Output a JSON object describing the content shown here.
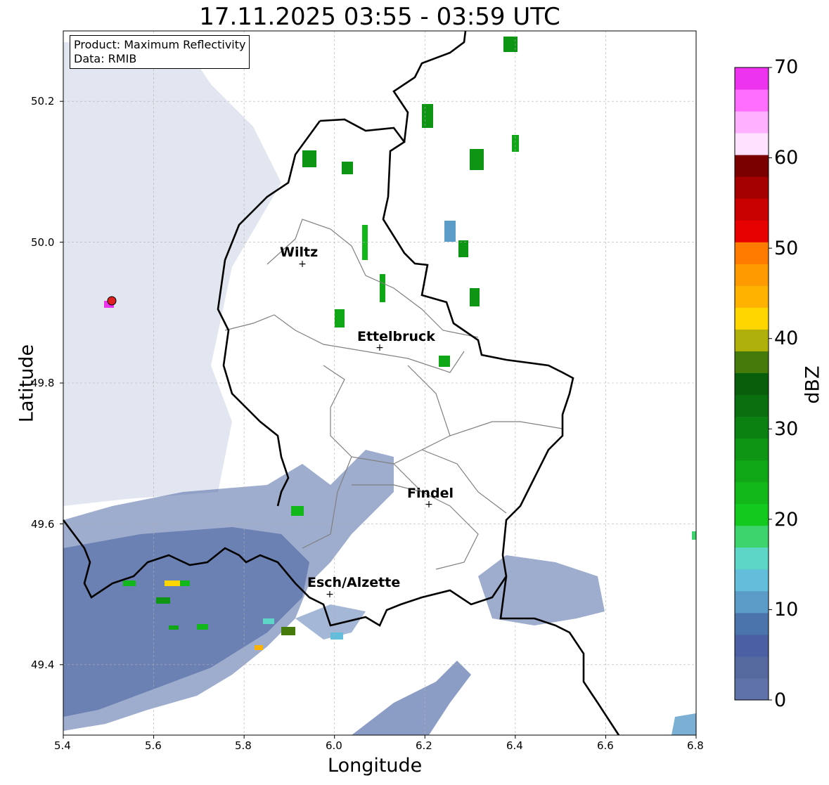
{
  "title": "17.11.2025 03:55 - 03:59 UTC",
  "info": {
    "product": "Product: Maximum Reflectivity",
    "data_source": "Data: RMIB"
  },
  "axes": {
    "xlabel": "Longitude",
    "ylabel": "Latitude",
    "xticks": [
      "5.4",
      "5.6",
      "5.8",
      "6.0",
      "6.2",
      "6.4",
      "6.6",
      "6.8"
    ],
    "yticks": [
      "49.4",
      "49.6",
      "49.8",
      "50.0",
      "50.2"
    ],
    "xlim": [
      5.4,
      6.8
    ],
    "ylim": [
      49.3,
      50.3
    ],
    "grid": true
  },
  "colorbar": {
    "unit": "dBZ",
    "ticks": [
      "0",
      "10",
      "20",
      "30",
      "40",
      "50",
      "60",
      "70"
    ],
    "colors": [
      "#5f73aa",
      "#56699f",
      "#4a60a3",
      "#4b74ad",
      "#5a9bc8",
      "#63bedb",
      "#5dd6c8",
      "#3dd46e",
      "#12c91e",
      "#12b81a",
      "#10a716",
      "#0e9513",
      "#0b8112",
      "#0a6f0f",
      "#095e0b",
      "#447b0b",
      "#b0b00a",
      "#ffd600",
      "#ffb300",
      "#ff9b00",
      "#ff7b00",
      "#e60000",
      "#c90000",
      "#a50000",
      "#7a0000",
      "#ffe2ff",
      "#ffb0ff",
      "#ff6eff",
      "#ee33ee"
    ]
  },
  "cities": [
    {
      "name": "Wiltz"
    },
    {
      "name": "Ettelbruck"
    },
    {
      "name": "Findel"
    },
    {
      "name": "Esch/Alzette"
    }
  ],
  "map_colors": {
    "border": "#000000",
    "canton_lines": "#808080",
    "gridline": "#b0b0b0",
    "radar_site": "#e02020",
    "radar_low": "#4b62a2"
  }
}
